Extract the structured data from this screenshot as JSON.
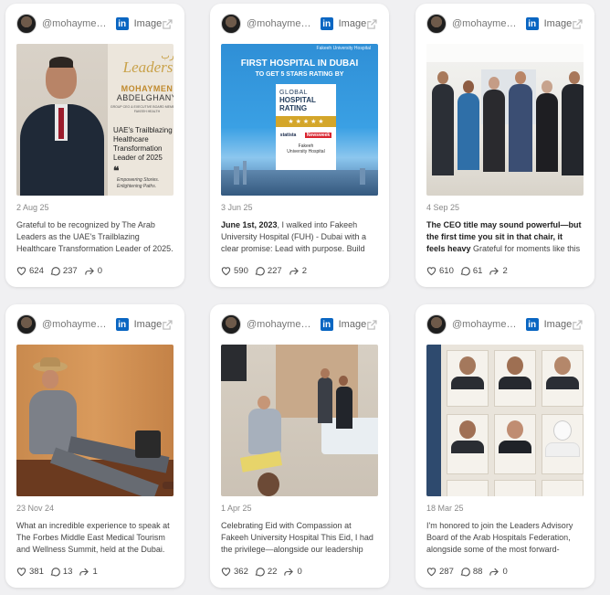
{
  "cards": [
    {
      "handle": "@mohaymenabdelghany",
      "type": "Image",
      "date": "2 Aug 25",
      "text": "Grateful to be recognized by The Arab Leaders as the UAE's Trailblazing Healthcare Transformation Leader of 2025.",
      "likes": "624",
      "comments": "237",
      "shares": "0",
      "media": {
        "brand": "Leaders",
        "brand_ar": "العرب",
        "name1": "MOHAYMEN",
        "name2": "ABDELGHANY",
        "role": "GROUP CEO & EXECUTIVE BOARD MEMBER AT FAKEEH HEALTH",
        "line1": "UAE's Trailblazing",
        "line2": "Healthcare",
        "line3": "Transformation",
        "line4": "Leader of 2025",
        "tag1": "Empowering Stories.",
        "tag2": "Enlightening Paths."
      }
    },
    {
      "handle": "@mohaymenabdelghany",
      "type": "Image",
      "date": "3 Jun 25",
      "text_bold": "June 1st, 2023",
      "text": ", I walked into Fakeeh University Hospital (FUH) - Dubai with a clear promise: Lead with purpose. Build trust.",
      "likes": "590",
      "comments": "227",
      "shares": "2",
      "media": {
        "top": "Fakeeh University Hospital",
        "h1": "FIRST HOSPITAL IN DUBAI",
        "h2": "TO GET 5 STARS RATING BY",
        "b1": "GLOBAL",
        "b2": "HOSPITAL",
        "b3": "RATING",
        "stars": "★ ★ ★ ★ ★",
        "sponsor1": "statista",
        "sponsor2": "Newsweek",
        "foot1": "Fakeeh",
        "foot2": "University Hospital"
      }
    },
    {
      "handle": "@mohaymenabdelghany",
      "type": "Image",
      "date": "4 Sep 25",
      "text_bold": "The CEO title may sound powerful—but the first time you sit in that chair, it feels heavy",
      "text": " Grateful for moments like this—walking the halls with the team.",
      "likes": "610",
      "comments": "61",
      "shares": "2"
    },
    {
      "handle": "@mohaymenabdelghany",
      "type": "Image",
      "date": "23 Nov 24",
      "text": "What an incredible experience to speak at The Forbes Middle East Medical Tourism and Wellness Summit, held at the Dubai.",
      "likes": "381",
      "comments": "13",
      "shares": "1"
    },
    {
      "handle": "@mohaymenabdelghany",
      "type": "Image",
      "date": "1 Apr 25",
      "text": "Celebrating Eid with Compassion at Fakeeh University Hospital This Eid, I had the privilege—alongside our leadership team.",
      "likes": "362",
      "comments": "22",
      "shares": "0"
    },
    {
      "handle": "@mohaymenabdelghany",
      "type": "Image",
      "date": "18 Mar 25",
      "text": "I'm honored to join the Leaders Advisory Board of the Arab Hospitals Federation, alongside some of the most forward-thinking leaders.",
      "likes": "287",
      "comments": "88",
      "shares": "0"
    }
  ],
  "colors": {
    "linkedin": "#0a66c2",
    "text": "#444444",
    "muted": "#888888",
    "bg": "#f0f0f2"
  }
}
